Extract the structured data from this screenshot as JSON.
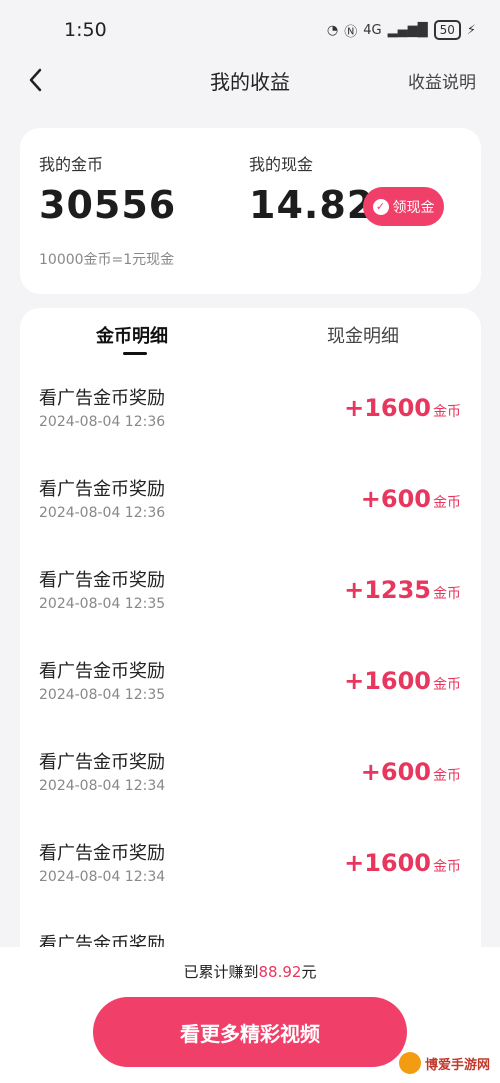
{
  "status_bar": {
    "time": "1:50",
    "network": "4G",
    "battery": "50"
  },
  "header": {
    "title": "我的收益",
    "help": "收益说明"
  },
  "balance": {
    "coin_label": "我的金币",
    "coin_value": "30556",
    "cash_label": "我的现金",
    "cash_value": "14.82",
    "cash_button": "领现金",
    "rate_note": "10000金币=1元现金"
  },
  "tabs": {
    "coin_detail": "金币明细",
    "cash_detail": "现金明细"
  },
  "records": [
    {
      "title": "看广告金币奖励",
      "time": "2024-08-04 12:36",
      "amount": "+1600",
      "unit": "金币"
    },
    {
      "title": "看广告金币奖励",
      "time": "2024-08-04 12:36",
      "amount": "+600",
      "unit": "金币"
    },
    {
      "title": "看广告金币奖励",
      "time": "2024-08-04 12:35",
      "amount": "+1235",
      "unit": "金币"
    },
    {
      "title": "看广告金币奖励",
      "time": "2024-08-04 12:35",
      "amount": "+1600",
      "unit": "金币"
    },
    {
      "title": "看广告金币奖励",
      "time": "2024-08-04 12:34",
      "amount": "+600",
      "unit": "金币"
    },
    {
      "title": "看广告金币奖励",
      "time": "2024-08-04 12:34",
      "amount": "+1600",
      "unit": "金币"
    },
    {
      "title": "看广告金币奖励",
      "time": "",
      "amount": "",
      "unit": ""
    }
  ],
  "footer": {
    "total_prefix": "已累计赚到",
    "total_amount": "88.92",
    "total_suffix": "元",
    "watch_button": "看更多精彩视频"
  },
  "watermark": "博爱手游网",
  "colors": {
    "accent": "#f0406a",
    "amount": "#e8375f",
    "background": "#f4f4f6"
  }
}
